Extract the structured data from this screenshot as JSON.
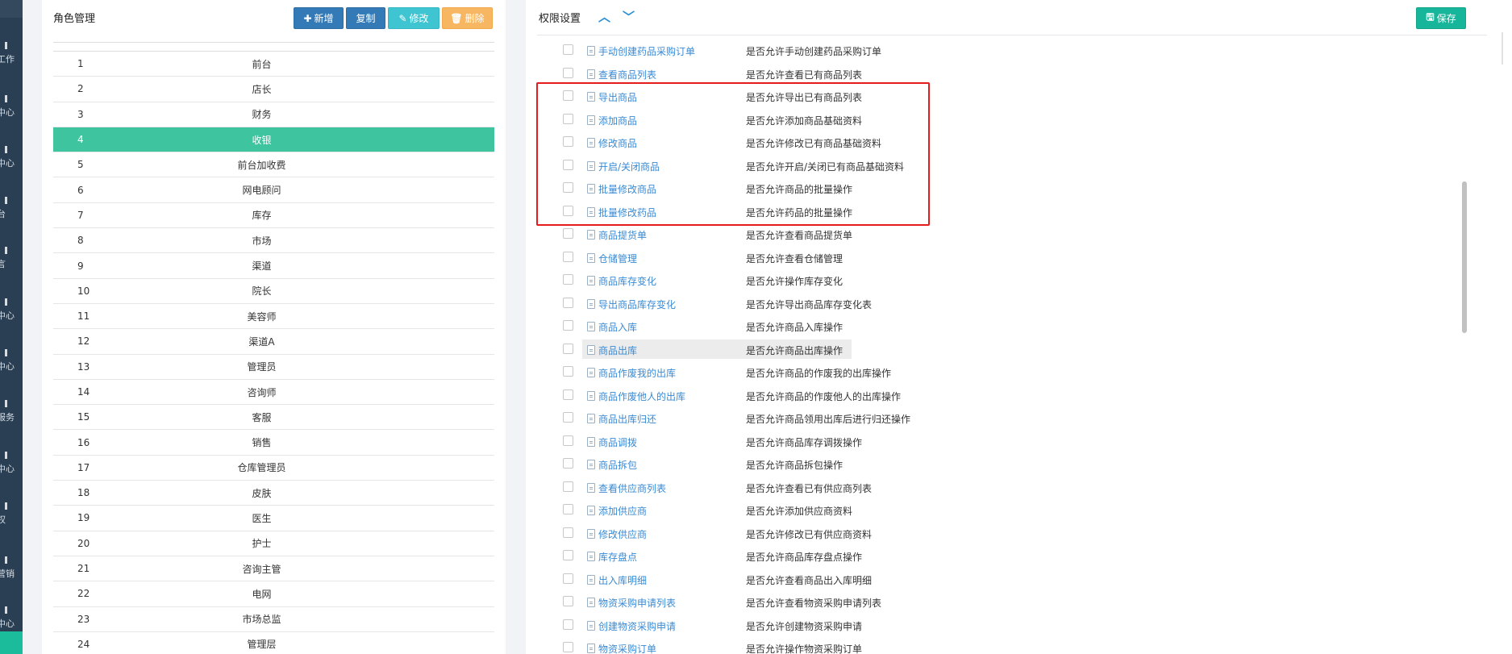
{
  "left_nav": {
    "items": [
      "工作",
      "中心",
      "中心",
      "台",
      "言",
      "中心",
      "中心",
      "服务",
      "中心",
      "权",
      "营销",
      "中心"
    ]
  },
  "roles_panel": {
    "title": "角色管理",
    "buttons": {
      "add": "新增",
      "copy": "复制",
      "edit": "修改",
      "delete": "删除"
    },
    "rows": [
      {
        "num": "1",
        "name": "前台"
      },
      {
        "num": "2",
        "name": "店长"
      },
      {
        "num": "3",
        "name": "财务"
      },
      {
        "num": "4",
        "name": "收银"
      },
      {
        "num": "5",
        "name": "前台加收费"
      },
      {
        "num": "6",
        "name": "网电顾问"
      },
      {
        "num": "7",
        "name": "库存"
      },
      {
        "num": "8",
        "name": "市场"
      },
      {
        "num": "9",
        "name": "渠道"
      },
      {
        "num": "10",
        "name": "院长"
      },
      {
        "num": "11",
        "name": "美容师"
      },
      {
        "num": "12",
        "name": "渠道A"
      },
      {
        "num": "13",
        "name": "管理员"
      },
      {
        "num": "14",
        "name": "咨询师"
      },
      {
        "num": "15",
        "name": "客服"
      },
      {
        "num": "16",
        "name": "销售"
      },
      {
        "num": "17",
        "name": "仓库管理员"
      },
      {
        "num": "18",
        "name": "皮肤"
      },
      {
        "num": "19",
        "name": "医生"
      },
      {
        "num": "20",
        "name": "护士"
      },
      {
        "num": "21",
        "name": "咨询主管"
      },
      {
        "num": "22",
        "name": "电网"
      },
      {
        "num": "23",
        "name": "市场总监"
      },
      {
        "num": "24",
        "name": "管理层"
      }
    ],
    "selected_row": "4"
  },
  "perm_panel": {
    "title": "权限设置",
    "save_label": "保存",
    "permissions": [
      {
        "name": "手动创建药品采购订单",
        "desc": "是否允许手动创建药品采购订单"
      },
      {
        "name": "查看商品列表",
        "desc": "是否允许查看已有商品列表"
      },
      {
        "name": "导出商品",
        "desc": "是否允许导出已有商品列表"
      },
      {
        "name": "添加商品",
        "desc": "是否允许添加商品基础资料"
      },
      {
        "name": "修改商品",
        "desc": "是否允许修改已有商品基础资料"
      },
      {
        "name": "开启/关闭商品",
        "desc": "是否允许开启/关闭已有商品基础资料"
      },
      {
        "name": "批量修改商品",
        "desc": "是否允许商品的批量操作"
      },
      {
        "name": "批量修改药品",
        "desc": "是否允许药品的批量操作"
      },
      {
        "name": "商品提货单",
        "desc": "是否允许查看商品提货单"
      },
      {
        "name": "仓储管理",
        "desc": "是否允许查看仓储管理"
      },
      {
        "name": "商品库存变化",
        "desc": "是否允许操作库存变化"
      },
      {
        "name": "导出商品库存变化",
        "desc": "是否允许导出商品库存变化表"
      },
      {
        "name": "商品入库",
        "desc": "是否允许商品入库操作"
      },
      {
        "name": "商品出库",
        "desc": "是否允许商品出库操作"
      },
      {
        "name": "商品作废我的出库",
        "desc": "是否允许商品的作废我的出库操作"
      },
      {
        "name": "商品作废他人的出库",
        "desc": "是否允许商品的作废他人的出库操作"
      },
      {
        "name": "商品出库归还",
        "desc": "是否允许商品领用出库后进行归还操作"
      },
      {
        "name": "商品调拨",
        "desc": "是否允许商品库存调拨操作"
      },
      {
        "name": "商品拆包",
        "desc": "是否允许商品拆包操作"
      },
      {
        "name": "查看供应商列表",
        "desc": "是否允许查看已有供应商列表"
      },
      {
        "name": "添加供应商",
        "desc": "是否允许添加供应商资料"
      },
      {
        "name": "修改供应商",
        "desc": "是否允许修改已有供应商资料"
      },
      {
        "name": "库存盘点",
        "desc": "是否允许商品库存盘点操作"
      },
      {
        "name": "出入库明细",
        "desc": "是否允许查看商品出入库明细"
      },
      {
        "name": "物资采购申请列表",
        "desc": "是否允许查看物资采购申请列表"
      },
      {
        "name": "创建物资采购申请",
        "desc": "是否允许创建物资采购申请"
      },
      {
        "name": "物资采购订单",
        "desc": "是否允许操作物资采购订单"
      }
    ],
    "hovered_row": "商品出库"
  },
  "colors": {
    "accent_green": "#3fc4a0",
    "link_blue": "#3a8ad4",
    "annotation_red": "#e51c1c"
  }
}
